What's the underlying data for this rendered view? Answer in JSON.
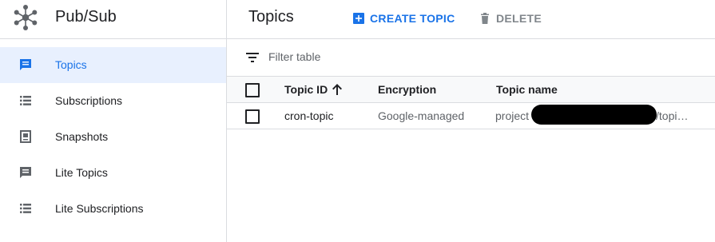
{
  "app": {
    "title": "Pub/Sub"
  },
  "sidebar": {
    "items": [
      {
        "label": "Topics",
        "icon": "topics-icon",
        "active": true
      },
      {
        "label": "Subscriptions",
        "icon": "subscriptions-list-icon",
        "active": false
      },
      {
        "label": "Snapshots",
        "icon": "snapshot-icon",
        "active": false
      },
      {
        "label": "Lite Topics",
        "icon": "lite-topics-icon",
        "active": false
      },
      {
        "label": "Lite Subscriptions",
        "icon": "lite-subscriptions-list-icon",
        "active": false
      }
    ]
  },
  "toolbar": {
    "title": "Topics",
    "create_label": "CREATE TOPIC",
    "delete_label": "DELETE"
  },
  "filter": {
    "placeholder": "Filter table"
  },
  "table": {
    "columns": [
      "Topic ID",
      "Encryption",
      "Topic name"
    ],
    "sort": {
      "column": "Topic ID",
      "direction": "ascending"
    },
    "rows": [
      {
        "topic_id": "cron-topic",
        "encryption": "Google-managed",
        "name_prefix": "project",
        "name_suffix": "/topi…"
      }
    ]
  },
  "colors": {
    "accent": "#1a73e8",
    "active_bg": "#e8f0fe",
    "disabled": "#80868b",
    "border": "#dadce0",
    "header_bg": "#f8f9fa"
  }
}
